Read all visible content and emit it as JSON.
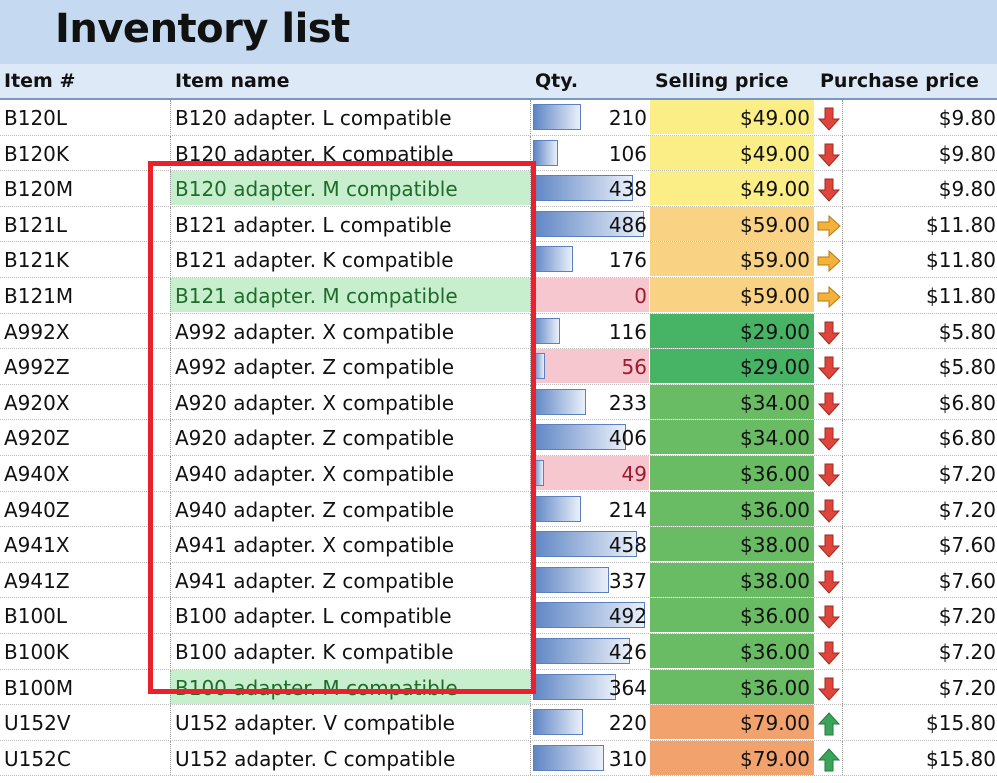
{
  "title": "Inventory list",
  "headers": {
    "item_id": "Item #",
    "item_name": "Item name",
    "qty": "Qty.",
    "selling_price": "Selling price",
    "purchase_price": "Purchase price"
  },
  "colors": {
    "sell_yellow": "#fbee87",
    "sell_light_orange": "#f9d283",
    "sell_green_dark": "#47b365",
    "sell_green": "#69bc63",
    "sell_orange": "#f2a36d",
    "name_highlight": "#c8efcd",
    "qty_low": "#f6c7cf",
    "arrow_down": "#e0453c",
    "arrow_right": "#f5b23a",
    "arrow_up": "#3aa55a",
    "selection_frame": "#e8212c"
  },
  "rows": [
    {
      "id": "B120L",
      "name": "B120 adapter. L compatible",
      "qty": "210",
      "qty_level": 0.43,
      "sell": "$49.00",
      "sell_color": "#fbee87",
      "arrow": "down-arrow-icon",
      "purchase": "$9.80",
      "hl": false,
      "low": false
    },
    {
      "id": "B120K",
      "name": "B120 adapter. K compatible",
      "qty": "106",
      "qty_level": 0.22,
      "sell": "$49.00",
      "sell_color": "#fbee87",
      "arrow": "down-arrow-icon",
      "purchase": "$9.80",
      "hl": false,
      "low": false
    },
    {
      "id": "B120M",
      "name": "B120 adapter. M compatible",
      "qty": "438",
      "qty_level": 0.89,
      "sell": "$49.00",
      "sell_color": "#fbee87",
      "arrow": "down-arrow-icon",
      "purchase": "$9.80",
      "hl": true,
      "low": false
    },
    {
      "id": "B121L",
      "name": "B121 adapter. L compatible",
      "qty": "486",
      "qty_level": 0.99,
      "sell": "$59.00",
      "sell_color": "#f9d283",
      "arrow": "right-arrow-icon",
      "purchase": "$11.80",
      "hl": false,
      "low": false
    },
    {
      "id": "B121K",
      "name": "B121 adapter. K compatible",
      "qty": "176",
      "qty_level": 0.36,
      "sell": "$59.00",
      "sell_color": "#f9d283",
      "arrow": "right-arrow-icon",
      "purchase": "$11.80",
      "hl": false,
      "low": false
    },
    {
      "id": "B121M",
      "name": "B121 adapter. M compatible",
      "qty": "0",
      "qty_level": 0.0,
      "sell": "$59.00",
      "sell_color": "#f9d283",
      "arrow": "right-arrow-icon",
      "purchase": "$11.80",
      "hl": true,
      "low": true
    },
    {
      "id": "A992X",
      "name": "A992 adapter. X compatible",
      "qty": "116",
      "qty_level": 0.24,
      "sell": "$29.00",
      "sell_color": "#47b365",
      "arrow": "down-arrow-icon",
      "purchase": "$5.80",
      "hl": false,
      "low": false
    },
    {
      "id": "A992Z",
      "name": "A992 adapter. Z compatible",
      "qty": "56",
      "qty_level": 0.11,
      "sell": "$29.00",
      "sell_color": "#47b365",
      "arrow": "down-arrow-icon",
      "purchase": "$5.80",
      "hl": false,
      "low": true
    },
    {
      "id": "A920X",
      "name": "A920 adapter. X compatible",
      "qty": "233",
      "qty_level": 0.47,
      "sell": "$34.00",
      "sell_color": "#69bc63",
      "arrow": "down-arrow-icon",
      "purchase": "$6.80",
      "hl": false,
      "low": false
    },
    {
      "id": "A920Z",
      "name": "A920 adapter. Z compatible",
      "qty": "406",
      "qty_level": 0.83,
      "sell": "$34.00",
      "sell_color": "#69bc63",
      "arrow": "down-arrow-icon",
      "purchase": "$6.80",
      "hl": false,
      "low": false
    },
    {
      "id": "A940X",
      "name": "A940 adapter. X compatible",
      "qty": "49",
      "qty_level": 0.1,
      "sell": "$36.00",
      "sell_color": "#69bc63",
      "arrow": "down-arrow-icon",
      "purchase": "$7.20",
      "hl": false,
      "low": true
    },
    {
      "id": "A940Z",
      "name": "A940 adapter. Z compatible",
      "qty": "214",
      "qty_level": 0.43,
      "sell": "$36.00",
      "sell_color": "#69bc63",
      "arrow": "down-arrow-icon",
      "purchase": "$7.20",
      "hl": false,
      "low": false
    },
    {
      "id": "A941X",
      "name": "A941 adapter. X compatible",
      "qty": "458",
      "qty_level": 0.93,
      "sell": "$38.00",
      "sell_color": "#69bc63",
      "arrow": "down-arrow-icon",
      "purchase": "$7.60",
      "hl": false,
      "low": false
    },
    {
      "id": "A941Z",
      "name": "A941 adapter. Z compatible",
      "qty": "337",
      "qty_level": 0.68,
      "sell": "$38.00",
      "sell_color": "#69bc63",
      "arrow": "down-arrow-icon",
      "purchase": "$7.60",
      "hl": false,
      "low": false
    },
    {
      "id": "B100L",
      "name": "B100 adapter. L compatible",
      "qty": "492",
      "qty_level": 1.0,
      "sell": "$36.00",
      "sell_color": "#69bc63",
      "arrow": "down-arrow-icon",
      "purchase": "$7.20",
      "hl": false,
      "low": false
    },
    {
      "id": "B100K",
      "name": "B100 adapter. K compatible",
      "qty": "426",
      "qty_level": 0.87,
      "sell": "$36.00",
      "sell_color": "#69bc63",
      "arrow": "down-arrow-icon",
      "purchase": "$7.20",
      "hl": false,
      "low": false
    },
    {
      "id": "B100M",
      "name": "B100 adapter. M compatible",
      "qty": "364",
      "qty_level": 0.74,
      "sell": "$36.00",
      "sell_color": "#69bc63",
      "arrow": "down-arrow-icon",
      "purchase": "$7.20",
      "hl": true,
      "low": false
    },
    {
      "id": "U152V",
      "name": "U152 adapter. V compatible",
      "qty": "220",
      "qty_level": 0.45,
      "sell": "$79.00",
      "sell_color": "#f2a36d",
      "arrow": "up-arrow-icon",
      "purchase": "$15.80",
      "hl": false,
      "low": false
    },
    {
      "id": "U152C",
      "name": "U152 adapter. C compatible",
      "qty": "310",
      "qty_level": 0.63,
      "sell": "$79.00",
      "sell_color": "#f2a36d",
      "arrow": "up-arrow-icon",
      "purchase": "$15.80",
      "hl": false,
      "low": false
    }
  ]
}
